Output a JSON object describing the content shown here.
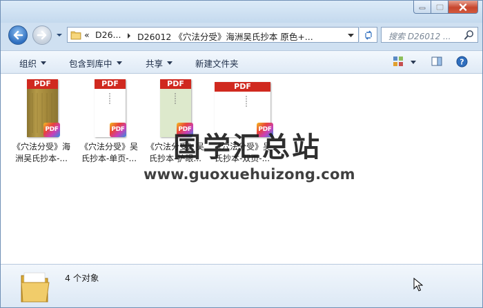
{
  "address": {
    "chevron": "«",
    "crumb1": "D26...",
    "crumb2": "D26012 《穴法分受》海洲吴氏抄本 原色+..."
  },
  "search": {
    "placeholder": "搜索 D26012 ..."
  },
  "toolbar": {
    "organize": "组织",
    "include_library": "包含到库中",
    "share": "共享",
    "new_folder": "新建文件夹"
  },
  "files": [
    {
      "line1": "《穴法分受》海",
      "line2": "洲吴氏抄本-...",
      "type_label": "PDF",
      "badge": "PDF"
    },
    {
      "line1": "《穴法分受》吴",
      "line2": "氏抄本-单页-...",
      "type_label": "PDF",
      "badge": "PDF"
    },
    {
      "line1": "《穴法分受》吴",
      "line2": "氏抄本-护眼...",
      "type_label": "PDF",
      "badge": "PDF"
    },
    {
      "line1": "《穴法分受》吴",
      "line2": "氏抄本-双页-...",
      "type_label": "PDF",
      "badge": "PDF"
    }
  ],
  "watermark": {
    "cn": "国学汇总站",
    "url": "www.guoxuehuizong.com"
  },
  "status": {
    "count": "4 个对象"
  },
  "colors": {
    "pdf_red": "#d0291f",
    "titlebar": "#c4d9ee",
    "close_red": "#c7462e"
  },
  "icons": [
    "minimize-icon",
    "maximize-icon",
    "close-icon",
    "back-arrow-icon",
    "forward-arrow-icon",
    "folder-icon",
    "refresh-icon",
    "search-icon",
    "view-icon",
    "preview-pane-icon",
    "help-icon",
    "cursor-icon"
  ]
}
